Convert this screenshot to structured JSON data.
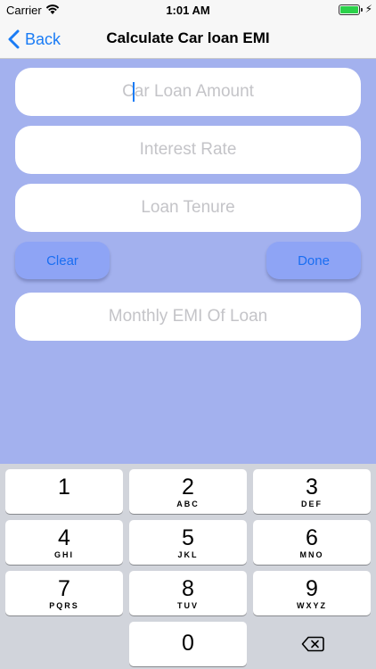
{
  "status_bar": {
    "carrier": "Carrier",
    "time": "1:01 AM"
  },
  "nav": {
    "back_label": "Back",
    "title": "Calculate Car loan EMI"
  },
  "form": {
    "loan_amount_placeholder": "Car Loan Amount",
    "interest_rate_placeholder": "Interest Rate",
    "loan_tenure_placeholder": "Loan Tenure",
    "monthly_emi_placeholder": "Monthly EMI Of Loan",
    "clear_label": "Clear",
    "done_label": "Done"
  },
  "keyboard": {
    "keys": [
      {
        "num": "1",
        "letters": ""
      },
      {
        "num": "2",
        "letters": "ABC"
      },
      {
        "num": "3",
        "letters": "DEF"
      },
      {
        "num": "4",
        "letters": "GHI"
      },
      {
        "num": "5",
        "letters": "JKL"
      },
      {
        "num": "6",
        "letters": "MNO"
      },
      {
        "num": "7",
        "letters": "PQRS"
      },
      {
        "num": "8",
        "letters": "TUV"
      },
      {
        "num": "9",
        "letters": "WXYZ"
      },
      {
        "num": "0",
        "letters": ""
      }
    ]
  },
  "colors": {
    "background": "#a3b1ee",
    "accent": "#1a7cf5",
    "button": "#8ea4f5"
  }
}
